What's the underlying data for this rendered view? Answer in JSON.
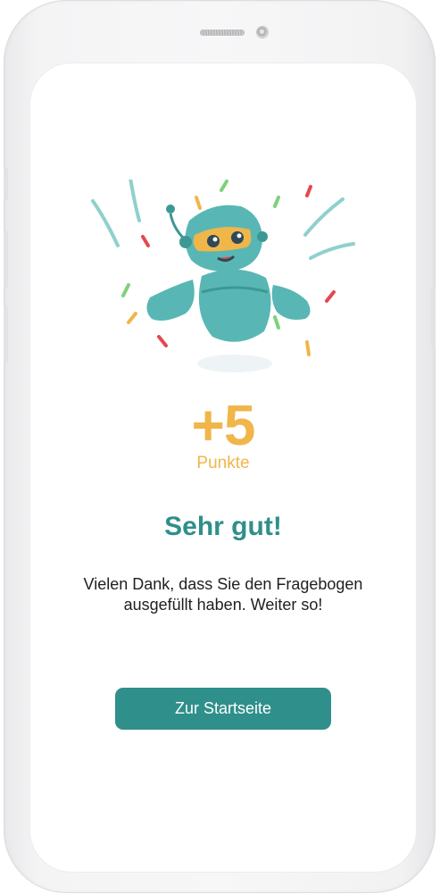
{
  "reward": {
    "points_value": "+5",
    "points_label": "Punkte"
  },
  "result": {
    "title": "Sehr gut!",
    "message": "Vielen Dank, dass Sie den Fragebogen ausgefüllt haben. Weiter so!"
  },
  "actions": {
    "home_button_label": "Zur Startseite"
  },
  "illustration": {
    "name": "celebrating-robot-illustration",
    "colors": {
      "robot_body": "#58b7b4",
      "robot_dark": "#3d9894",
      "visor": "#f0b64a",
      "confetti_red": "#e5484d",
      "confetti_green": "#7ed17b",
      "confetti_orange": "#f0b64a",
      "motion_lines": "#8fd0cc"
    }
  },
  "theme": {
    "accent": "#2f8f8b",
    "points_color": "#f0b64a",
    "text": "#1f1f1f",
    "background": "#ffffff"
  }
}
